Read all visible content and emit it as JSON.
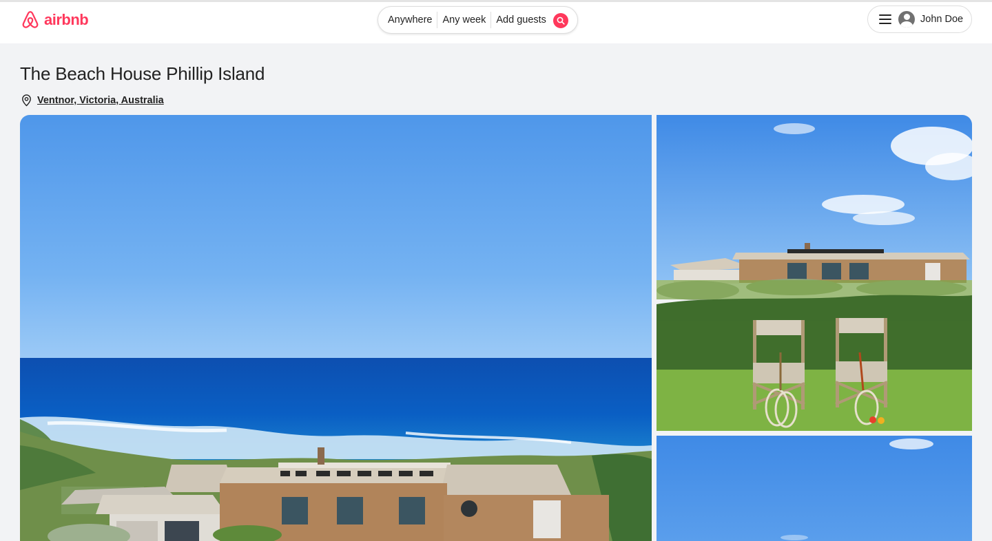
{
  "brand": {
    "name": "airbnb",
    "color": "#ff385c"
  },
  "search": {
    "where": "Anywhere",
    "when": "Any week",
    "who": "Add guests",
    "button_icon": "search-icon"
  },
  "user_menu": {
    "menu_icon": "hamburger-menu-icon",
    "avatar_icon": "user-avatar-icon",
    "name": "John Doe"
  },
  "listing": {
    "title": "The Beach House Phillip Island",
    "location_icon": "map-pin-icon",
    "location": "Ventnor, Victoria, Australia"
  },
  "photos": [
    {
      "name": "main-photo",
      "depicts": "ocean-view-house"
    },
    {
      "name": "side-photo-1",
      "depicts": "chairs-tennis-rackets-lawn"
    },
    {
      "name": "side-photo-2",
      "depicts": "sky"
    }
  ]
}
